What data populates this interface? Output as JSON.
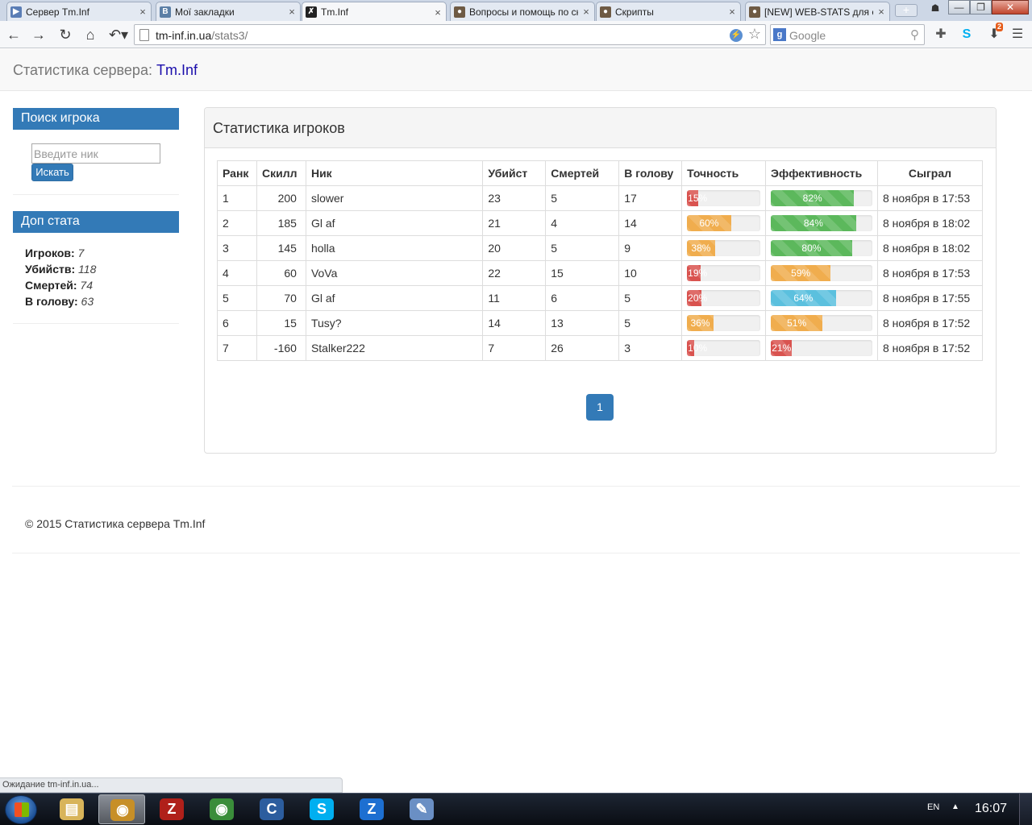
{
  "browser": {
    "tabs": [
      {
        "title": "Сервер Tm.Inf",
        "icon_color": "#5a7db5",
        "icon_glyph": "▶"
      },
      {
        "title": "Мої закладки",
        "icon_color": "#5b7fa6",
        "icon_glyph": "В"
      },
      {
        "title": "Tm.Inf",
        "icon_color": "#222222",
        "icon_glyph": "✗"
      },
      {
        "title": "Вопросы и помощь по скр",
        "icon_color": "#6e5a44",
        "icon_glyph": "●"
      },
      {
        "title": "Скрипты",
        "icon_color": "#6e5a44",
        "icon_glyph": "●"
      },
      {
        "title": "[NEW] WEB-STATS для cs",
        "icon_color": "#6e5a44",
        "icon_glyph": "●"
      }
    ],
    "tab_close": "×",
    "new_tab": "+",
    "url_host": "tm-inf.in.ua",
    "url_path": "/stats3/",
    "search_engine": "Google",
    "download_badge": "2",
    "window_buttons": {
      "minimize": "—",
      "maximize": "❐",
      "close": "✕"
    },
    "nav": {
      "back": "←",
      "forward": "→",
      "reload": "↻",
      "home": "⌂",
      "undo": "↶▾"
    }
  },
  "header": {
    "brand_prefix": "Статистика сервера:",
    "brand_link": "Tm.Inf"
  },
  "sidebar": {
    "search_title": "Поиск игрока",
    "search_placeholder": "Введите ник",
    "search_button": "Искать",
    "extra_title": "Доп стата",
    "stats": [
      {
        "label": "Игроков:",
        "value": "7"
      },
      {
        "label": "Убийств:",
        "value": "118"
      },
      {
        "label": "Смертей:",
        "value": "74"
      },
      {
        "label": "В голову:",
        "value": "63"
      }
    ]
  },
  "panel": {
    "title": "Статистика игроков",
    "columns": [
      "Ранк",
      "Скилл",
      "Ник",
      "Убийст",
      "Смертей",
      "В голову",
      "Точность",
      "Эффективность",
      "Сыграл"
    ],
    "rows": [
      {
        "rank": "1",
        "skill": "200",
        "nick": "slower",
        "kills": "23",
        "deaths": "5",
        "head": "17",
        "accuracy": 15,
        "acc_label": "15%",
        "acc_color": "danger",
        "efficiency": 82,
        "eff_label": "82%",
        "eff_color": "success",
        "played": "8 ноября в 17:53"
      },
      {
        "rank": "2",
        "skill": "185",
        "nick": "Gl af",
        "kills": "21",
        "deaths": "4",
        "head": "14",
        "accuracy": 60,
        "acc_label": "60%",
        "acc_color": "warning",
        "efficiency": 84,
        "eff_label": "84%",
        "eff_color": "success",
        "played": "8 ноября в 18:02"
      },
      {
        "rank": "3",
        "skill": "145",
        "nick": "holla",
        "kills": "20",
        "deaths": "5",
        "head": "9",
        "accuracy": 38,
        "acc_label": "38%",
        "acc_color": "warning",
        "efficiency": 80,
        "eff_label": "80%",
        "eff_color": "success",
        "played": "8 ноября в 18:02"
      },
      {
        "rank": "4",
        "skill": "60",
        "nick": "VoVa",
        "kills": "22",
        "deaths": "15",
        "head": "10",
        "accuracy": 19,
        "acc_label": "19%",
        "acc_color": "danger",
        "efficiency": 59,
        "eff_label": "59%",
        "eff_color": "warning",
        "played": "8 ноября в 17:53"
      },
      {
        "rank": "5",
        "skill": "70",
        "nick": "Gl af",
        "kills": "11",
        "deaths": "6",
        "head": "5",
        "accuracy": 20,
        "acc_label": "20%",
        "acc_color": "danger",
        "efficiency": 64,
        "eff_label": "64%",
        "eff_color": "info",
        "played": "8 ноября в 17:55"
      },
      {
        "rank": "6",
        "skill": "15",
        "nick": "Tusy?",
        "kills": "14",
        "deaths": "13",
        "head": "5",
        "accuracy": 36,
        "acc_label": "36%",
        "acc_color": "warning",
        "efficiency": 51,
        "eff_label": "51%",
        "eff_color": "warning",
        "played": "8 ноября в 17:52"
      },
      {
        "rank": "7",
        "skill": "-160",
        "nick": "Stalker222",
        "kills": "7",
        "deaths": "26",
        "head": "3",
        "accuracy": 10,
        "acc_label": "10%",
        "acc_color": "danger",
        "efficiency": 21,
        "eff_label": "21%",
        "eff_color": "danger",
        "played": "8 ноября в 17:52"
      }
    ],
    "pagination": [
      "1"
    ]
  },
  "footer": {
    "copyright": "© 2015 Статистика сервера Tm.Inf"
  },
  "statusbar": {
    "text": "Ожидание tm-inf.in.ua..."
  },
  "taskbar": {
    "apps": [
      {
        "name": "file-explorer",
        "color": "#d8b45a",
        "glyph": "▤"
      },
      {
        "name": "chrome-canary",
        "color": "#c78f27",
        "glyph": "◉"
      },
      {
        "name": "filezilla",
        "color": "#b0201a",
        "glyph": "Z"
      },
      {
        "name": "chrome",
        "color": "#3a8d3a",
        "glyph": "◉"
      },
      {
        "name": "ccleaner",
        "color": "#2c5d9e",
        "glyph": "C"
      },
      {
        "name": "skype",
        "color": "#00aff0",
        "glyph": "S"
      },
      {
        "name": "zona",
        "color": "#1d6fd1",
        "glyph": "Z"
      },
      {
        "name": "paint",
        "color": "#6a8fc4",
        "glyph": "✎"
      }
    ],
    "lang": "EN",
    "clock": "16:07"
  }
}
